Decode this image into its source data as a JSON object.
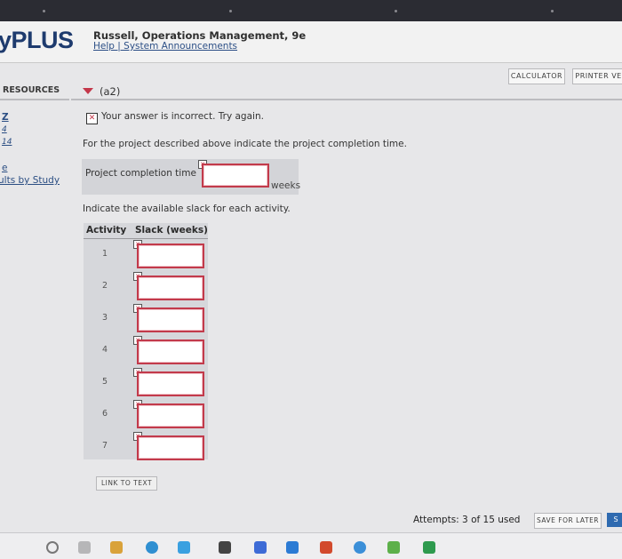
{
  "header": {
    "logo_text": "yPLUS",
    "book_title": "Russell, Operations Management, 9e",
    "help_links": "Help | System Announcements"
  },
  "toolbar": {
    "calculator_label": "CALCULATOR",
    "printer_label": "PRINTER VEI"
  },
  "sidebar": {
    "heading": "RESOURCES",
    "link_1": "Z",
    "link_2": "4",
    "link_3": "14",
    "link_4": "e",
    "link_5": "ults by Study"
  },
  "question": {
    "part_label": "(a2)",
    "feedback_icon": "x-mark-icon",
    "feedback_text": "Your answer is incorrect.  Try again.",
    "prompt_completion": "For the project described above indicate the project completion time.",
    "completion_label": "Project completion time",
    "completion_value": "",
    "completion_unit": "weeks",
    "prompt_slack": "Indicate the available slack for each activity.",
    "table": {
      "col_activity": "Activity",
      "col_slack": "Slack (weeks)",
      "rows": [
        {
          "activity": "1",
          "slack": ""
        },
        {
          "activity": "2",
          "slack": ""
        },
        {
          "activity": "3",
          "slack": ""
        },
        {
          "activity": "4",
          "slack": ""
        },
        {
          "activity": "5",
          "slack": ""
        },
        {
          "activity": "6",
          "slack": ""
        },
        {
          "activity": "7",
          "slack": ""
        }
      ]
    },
    "link_to_text_label": "LINK TO TEXT"
  },
  "footer": {
    "attempts_text": "Attempts: 3 of 15 used",
    "save_later_label": "SAVE FOR LATER",
    "submit_label": "S"
  },
  "colors": {
    "error_red": "#c23a4b",
    "link_blue": "#2b4e83",
    "logo_navy": "#1e3b6e",
    "table_bg": "#d6d7db"
  }
}
